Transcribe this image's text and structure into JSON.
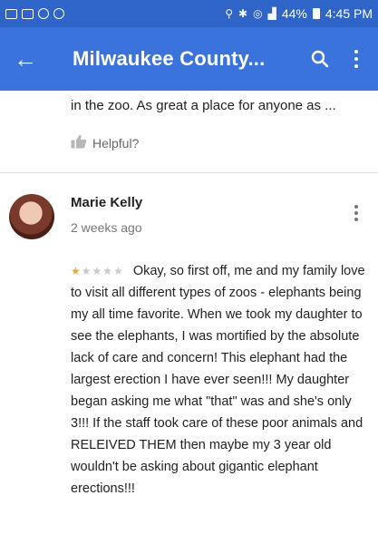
{
  "status_bar": {
    "battery": "44%",
    "time": "4:45 PM"
  },
  "toolbar": {
    "back_icon": "arrow-back-icon",
    "title": "Milwaukee County...",
    "search_icon": "search-icon",
    "menu_icon": "more-vert-icon"
  },
  "previous_review": {
    "snippet": "in the zoo. As great a place for anyone as ...",
    "helpful_label": "Helpful?"
  },
  "review": {
    "author": "Marie Kelly",
    "posted": "2 weeks ago",
    "rating": 1,
    "max_rating": 5,
    "text": "Okay, so first off, me and my family love to visit all different types of zoos - elephants being my all time favorite. When we took my daughter to see the elephants, I was mortified by the absolute lack of care and concern! This elephant had the largest erection I have ever seen!!! My daughter began asking me what \"that\" was and she's only 3!!! If the staff took care of these poor animals and RELEIVED THEM then maybe my 3 year old wouldn't be asking about gigantic elephant erections!!!"
  },
  "colors": {
    "status_bar": "#2f64c8",
    "toolbar": "#3b73dc",
    "star_on": "#e2a93b",
    "star_off": "#c9c9c9"
  }
}
